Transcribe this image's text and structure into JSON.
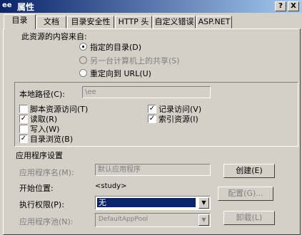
{
  "window": {
    "icon": "ee",
    "title": "属性",
    "help_btn": "?",
    "close_btn": "X"
  },
  "tabs": [
    "目录",
    "文档",
    "目录安全性",
    "HTTP 头",
    "自定义错误",
    "ASP.NET"
  ],
  "source": {
    "heading": "此资源的内容来自:",
    "options": [
      "指定的目录(D)",
      "另一台计算机上的共享(S)",
      "重定向到 URL(U)"
    ]
  },
  "local_path": {
    "label": "本地路径(C):",
    "value": "\\ee"
  },
  "checks": {
    "script_access": "脚本资源访问(T)",
    "read": "读取(R)",
    "write": "写入(W)",
    "dir_browse": "目录浏览(B)",
    "log_visits": "记录访问(V)",
    "index": "索引资源(I)"
  },
  "app": {
    "heading": "应用程序设置",
    "name_label": "应用程序名(M):",
    "name_value": "默认应用程序",
    "start_label": "开始位置:",
    "start_value": "<study>",
    "exec_label": "执行权限(P):",
    "exec_value": "无",
    "pool_label": "应用程序池(N):",
    "pool_value": "DefaultAppPool",
    "create_btn": "创建(E)",
    "config_btn": "配置(G)...",
    "unload_btn": "卸载(L)"
  },
  "colors": {
    "title_start": "#0a246a",
    "title_end": "#a6caf0",
    "face": "#d4d0c8",
    "select": "#0a246a"
  }
}
